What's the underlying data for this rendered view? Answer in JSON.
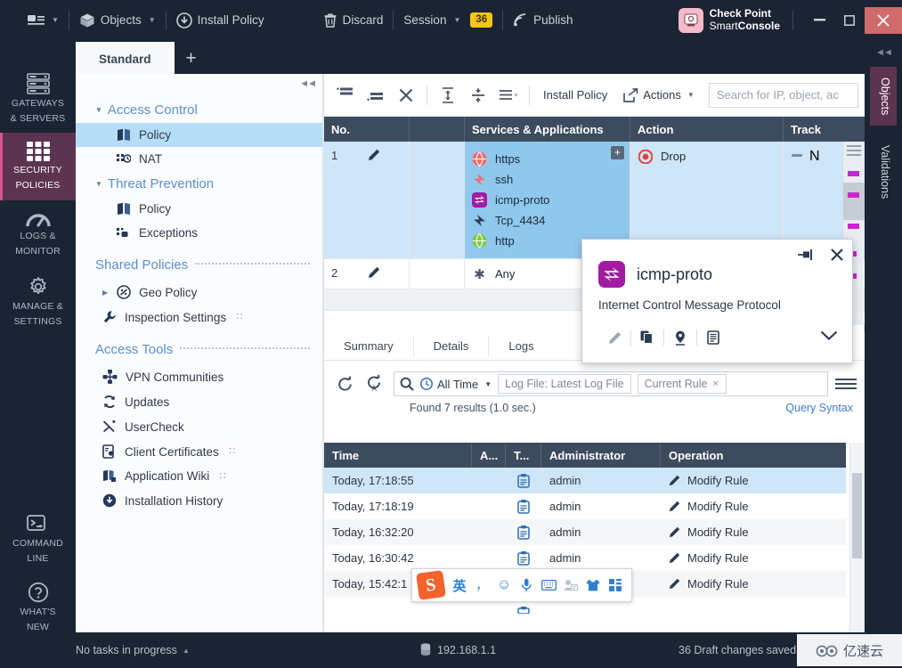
{
  "topbar": {
    "menu_icon": "menu-list-icon",
    "objects": "Objects",
    "install_policy": "Install Policy",
    "discard": "Discard",
    "session": "Session",
    "session_count": "36",
    "publish": "Publish",
    "brand_line1": "Check Point",
    "brand_line2_a": "Smart",
    "brand_line2_b": "Console",
    "win_minimize": "—",
    "win_maximize": "☐",
    "win_close": "✕"
  },
  "tabs": {
    "items": [
      {
        "label": "Standard",
        "active": true
      }
    ],
    "add_label": "+"
  },
  "rail": {
    "items": [
      {
        "icon": "servers-icon",
        "line1": "GATEWAYS",
        "line2": "& SERVERS",
        "active": false
      },
      {
        "icon": "grid-icon",
        "line1": "SECURITY",
        "line2": "POLICIES",
        "active": true
      },
      {
        "icon": "gauge-icon",
        "line1": "LOGS &",
        "line2": "MONITOR",
        "active": false
      },
      {
        "icon": "gear-icon",
        "line1": "MANAGE &",
        "line2": "SETTINGS",
        "active": false
      },
      {
        "icon": "terminal-icon",
        "line1": "COMMAND",
        "line2": "LINE",
        "active": false
      },
      {
        "icon": "question-icon",
        "line1": "WHAT'S",
        "line2": "NEW",
        "active": false
      }
    ]
  },
  "tree": {
    "groups": [
      {
        "label": "Access Control",
        "items": [
          {
            "label": "Policy",
            "icon": "book-icon",
            "selected": true,
            "external": false
          },
          {
            "label": "NAT",
            "icon": "nat-icon",
            "selected": false,
            "external": false
          }
        ]
      },
      {
        "label": "Threat Prevention",
        "items": [
          {
            "label": "Policy",
            "icon": "book-icon",
            "selected": false,
            "external": false
          },
          {
            "label": "Exceptions",
            "icon": "exception-icon",
            "selected": false,
            "external": false
          }
        ]
      }
    ],
    "shared_policies_header": "Shared Policies",
    "shared_policies": [
      {
        "label": "Geo Policy",
        "icon": "geo-icon",
        "external": false,
        "expandable": true
      },
      {
        "label": "Inspection Settings",
        "icon": "wrench-icon",
        "external": true,
        "expandable": false
      }
    ],
    "access_tools_header": "Access Tools",
    "access_tools": [
      {
        "label": "VPN Communities",
        "icon": "vpn-icon",
        "external": false
      },
      {
        "label": "Updates",
        "icon": "refresh-icon",
        "external": false
      },
      {
        "label": "UserCheck",
        "icon": "usercheck-icon",
        "external": false
      },
      {
        "label": "Client Certificates",
        "icon": "certificate-icon",
        "external": true
      },
      {
        "label": "Application Wiki",
        "icon": "wiki-icon",
        "external": true
      },
      {
        "label": "Installation History",
        "icon": "download-icon",
        "external": false
      }
    ]
  },
  "rules_toolbar": {
    "buttons": [
      "add-rule-above-icon",
      "add-rule-below-icon",
      "delete-rule-icon",
      "expand-all-icon",
      "collapse-all-icon",
      "view-options-icon"
    ],
    "install_policy": "Install Policy",
    "actions": "Actions",
    "search_placeholder": "Search for IP, object, ac"
  },
  "rules_table": {
    "columns": [
      "No.",
      "",
      "Services & Applications",
      "Action",
      "Track"
    ],
    "rows": [
      {
        "no": "1",
        "selected": true,
        "services": [
          {
            "name": "https",
            "icon": "globe-red-icon"
          },
          {
            "name": "ssh",
            "icon": "bolt-red-icon"
          },
          {
            "name": "icmp-proto",
            "icon": "proto-purple-icon"
          },
          {
            "name": "Tcp_4434",
            "icon": "bolt-dark-icon"
          },
          {
            "name": "http",
            "icon": "globe-green-icon"
          }
        ],
        "action": "Drop",
        "action_icon": "drop-red-icon",
        "track": "N",
        "plus_label": "+"
      },
      {
        "no": "2",
        "selected": false,
        "services": [
          {
            "name": "Any",
            "icon": "asterisk-icon"
          }
        ],
        "action": "",
        "action_icon": "",
        "track": ""
      }
    ]
  },
  "detail_tabs": [
    {
      "label": "Summary"
    },
    {
      "label": "Details"
    },
    {
      "label": "Logs"
    }
  ],
  "log_search": {
    "refresh_icon": "refresh-icon",
    "auto_refresh_icon": "auto-refresh-icon",
    "search_icon": "search-icon",
    "time_filter": "All Time",
    "chip_logfile": "Log File: Latest Log File",
    "chip_rule": "Current Rule",
    "menu_icon": "hamburger-icon",
    "results_text": "Found 7 results (1.0 sec.)",
    "query_syntax": "Query Syntax"
  },
  "log_table": {
    "columns": [
      "Time",
      "A...",
      "T...",
      "Administrator",
      "Operation"
    ],
    "rows": [
      {
        "time": "Today, 17:18:55",
        "a": "",
        "t": "clipboard-icon",
        "administrator": "admin",
        "operation": "Modify Rule",
        "op_icon": "pencil-icon",
        "selected": true
      },
      {
        "time": "Today, 17:18:19",
        "a": "",
        "t": "clipboard-icon",
        "administrator": "admin",
        "operation": "Modify Rule",
        "op_icon": "pencil-icon",
        "selected": false
      },
      {
        "time": "Today, 16:32:20",
        "a": "",
        "t": "clipboard-icon",
        "administrator": "admin",
        "operation": "Modify Rule",
        "op_icon": "pencil-icon",
        "selected": false
      },
      {
        "time": "Today, 16:30:42",
        "a": "",
        "t": "clipboard-icon",
        "administrator": "admin",
        "operation": "Modify Rule",
        "op_icon": "pencil-icon",
        "selected": false
      },
      {
        "time": "Today, 15:42:1",
        "a": "",
        "t": "clipboard-icon",
        "administrator": "",
        "operation": "Modify Rule",
        "op_icon": "pencil-icon",
        "selected": false
      }
    ]
  },
  "object_popup": {
    "title": "icmp-proto",
    "description": "Internet Control Message Protocol",
    "icon": "proto-purple-icon",
    "pin_icon": "pin-icon",
    "close_icon": "close-icon",
    "actions": [
      "edit-pencil-icon",
      "clone-icon",
      "where-used-pin-icon",
      "report-icon"
    ],
    "expand_icon": "chevron-down-icon"
  },
  "right_rail": {
    "collapse_icon": "collapse-left-icon",
    "tabs": [
      {
        "label": "Objects",
        "active": true
      },
      {
        "label": "Validations",
        "active": false
      }
    ]
  },
  "statusbar": {
    "tasks": "No tasks in progress",
    "tasks_caret": "▲",
    "server_icon": "server-icon",
    "server_ip": "192.168.1.1",
    "draft": "36 Draft changes saved"
  },
  "ime_toolbar": {
    "logo": "S",
    "items": [
      "英",
      "，",
      "☺",
      "mic-icon",
      "keyboard-icon",
      "contact-icon",
      "skin-icon",
      "apps-icon"
    ]
  },
  "watermark": {
    "text": "亿速云",
    "icon": "cloud-icon"
  },
  "colors": {
    "chrome_dark": "#1b2433",
    "accent_purple": "#5d3450",
    "accent_pink": "#d9558f",
    "selection_blue": "#cfe6f8",
    "service_cell_blue": "#8fc8ec",
    "header_slate": "#3d4b5e",
    "link_blue": "#3f7fd0",
    "badge_yellow": "#f5c518",
    "drop_red": "#e0443e",
    "icmp_purple": "#a21ca2"
  }
}
